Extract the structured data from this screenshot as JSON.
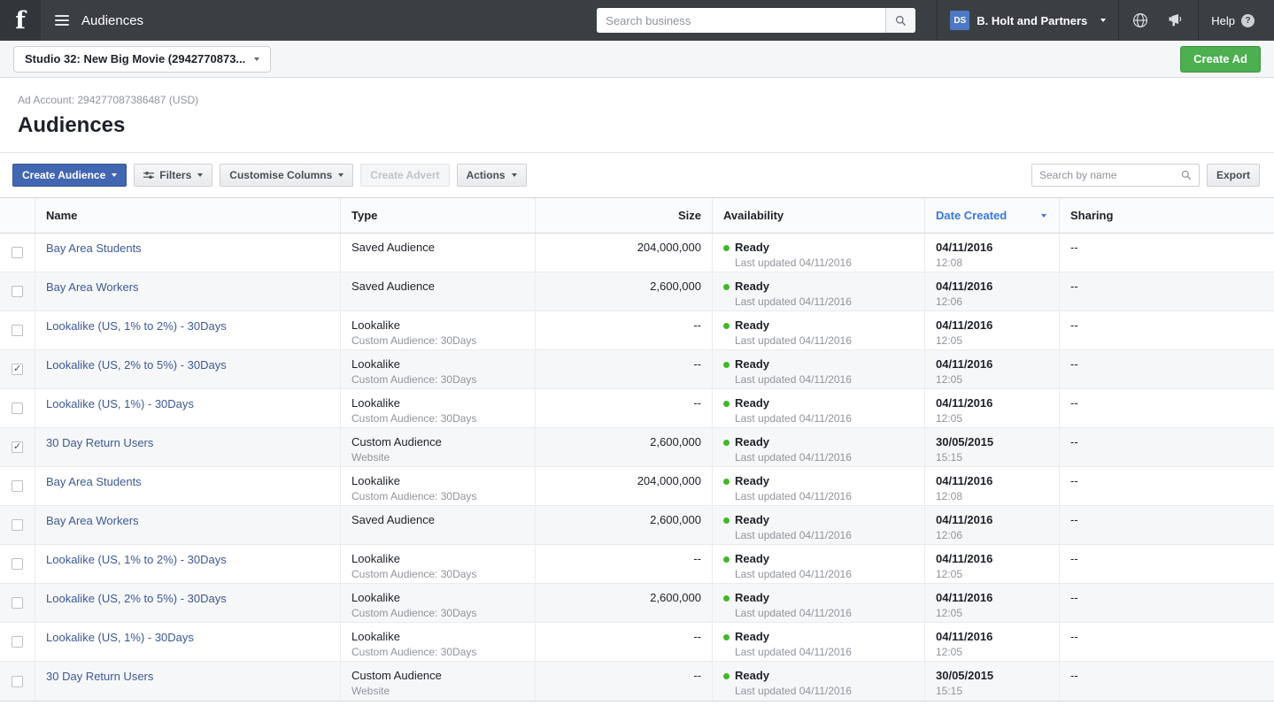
{
  "colors": {
    "topbar_bg": "#3a3f44",
    "brand_blue": "#4267b2",
    "link_blue": "#3b5998",
    "sorted_column_blue": "#3578e5",
    "create_ad_green": "#4caf50",
    "status_ready_green": "#42b72a"
  },
  "topbar": {
    "title": "Audiences",
    "search_placeholder": "Search business",
    "avatar_initials": "DS",
    "business_name": "B. Holt and Partners",
    "help_label": "Help"
  },
  "subheader": {
    "account_selector": "Studio 32: New Big Movie (2942770873...",
    "create_ad": "Create Ad"
  },
  "page": {
    "ad_account": "Ad Account: 294277087386487 (USD)",
    "title": "Audiences"
  },
  "toolbar": {
    "create_audience": "Create Audience",
    "filters": "Filters",
    "customise_columns": "Customise Columns",
    "create_advert": "Create Advert",
    "actions": "Actions",
    "search_placeholder": "Search by name",
    "export": "Export"
  },
  "table": {
    "headers": {
      "name": "Name",
      "type": "Type",
      "size": "Size",
      "availability": "Availability",
      "date_created": "Date Created",
      "sharing": "Sharing"
    },
    "rows": [
      {
        "name": "Bay Area Students",
        "type": "Saved Audience",
        "type_sub": "",
        "size": "204,000,000",
        "status": "Ready",
        "status_sub": "Last updated 04/11/2016",
        "date": "04/11/2016",
        "time": "12:08",
        "sharing": "--",
        "checked": false
      },
      {
        "name": "Bay Area Workers",
        "type": "Saved Audience",
        "type_sub": "",
        "size": "2,600,000",
        "status": "Ready",
        "status_sub": "Last updated 04/11/2016",
        "date": "04/11/2016",
        "time": "12:06",
        "sharing": "--",
        "checked": false
      },
      {
        "name": "Lookalike (US, 1% to 2%) - 30Days",
        "type": "Lookalike",
        "type_sub": "Custom Audience: 30Days",
        "size": "--",
        "status": "Ready",
        "status_sub": "Last updated 04/11/2016",
        "date": "04/11/2016",
        "time": "12:05",
        "sharing": "--",
        "checked": false
      },
      {
        "name": "Lookalike (US, 2% to 5%) - 30Days",
        "type": "Lookalike",
        "type_sub": "Custom Audience: 30Days",
        "size": "--",
        "status": "Ready",
        "status_sub": "Last updated 04/11/2016",
        "date": "04/11/2016",
        "time": "12:05",
        "sharing": "--",
        "checked": true
      },
      {
        "name": "Lookalike (US, 1%) - 30Days",
        "type": "Lookalike",
        "type_sub": "Custom Audience: 30Days",
        "size": "--",
        "status": "Ready",
        "status_sub": "Last updated 04/11/2016",
        "date": "04/11/2016",
        "time": "12:05",
        "sharing": "--",
        "checked": false
      },
      {
        "name": "30 Day Return Users",
        "type": "Custom Audience",
        "type_sub": "Website",
        "size": "2,600,000",
        "status": "Ready",
        "status_sub": "Last updated 04/11/2016",
        "date": "30/05/2015",
        "time": "15:15",
        "sharing": "--",
        "checked": true
      },
      {
        "name": "Bay Area Students",
        "type": "Lookalike",
        "type_sub": "Custom Audience: 30Days",
        "size": "204,000,000",
        "status": "Ready",
        "status_sub": "Last updated 04/11/2016",
        "date": "04/11/2016",
        "time": "12:08",
        "sharing": "--",
        "checked": false
      },
      {
        "name": "Bay Area Workers",
        "type": "Saved Audience",
        "type_sub": "",
        "size": "2,600,000",
        "status": "Ready",
        "status_sub": "Last updated 04/11/2016",
        "date": "04/11/2016",
        "time": "12:06",
        "sharing": "--",
        "checked": false
      },
      {
        "name": "Lookalike (US, 1% to 2%) - 30Days",
        "type": "Lookalike",
        "type_sub": "Custom Audience: 30Days",
        "size": "--",
        "status": "Ready",
        "status_sub": "Last updated 04/11/2016",
        "date": "04/11/2016",
        "time": "12:05",
        "sharing": "--",
        "checked": false
      },
      {
        "name": "Lookalike (US, 2% to 5%) - 30Days",
        "type": "Lookalike",
        "type_sub": "Custom Audience: 30Days",
        "size": "2,600,000",
        "status": "Ready",
        "status_sub": "Last updated 04/11/2016",
        "date": "04/11/2016",
        "time": "12:05",
        "sharing": "--",
        "checked": false
      },
      {
        "name": "Lookalike (US, 1%) - 30Days",
        "type": "Lookalike",
        "type_sub": "Custom Audience: 30Days",
        "size": "--",
        "status": "Ready",
        "status_sub": "Last updated 04/11/2016",
        "date": "04/11/2016",
        "time": "12:05",
        "sharing": "--",
        "checked": false
      },
      {
        "name": "30 Day Return Users",
        "type": "Custom Audience",
        "type_sub": "Website",
        "size": "--",
        "status": "Ready",
        "status_sub": "Last updated 04/11/2016",
        "date": "30/05/2015",
        "time": "15:15",
        "sharing": "--",
        "checked": false
      }
    ]
  }
}
